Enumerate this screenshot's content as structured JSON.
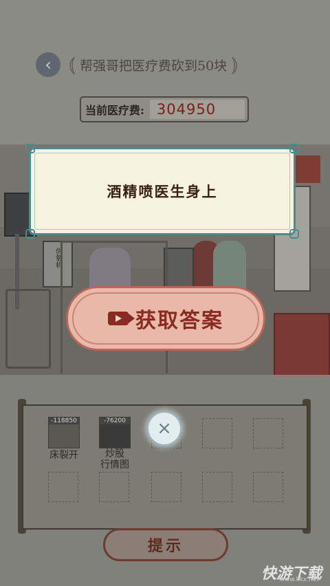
{
  "header": {
    "back_icon": "chevron-left-icon",
    "title": "帮强哥把医疗费砍到50块",
    "title_brace_left": "⦅",
    "title_brace_right": "⦆"
  },
  "fee": {
    "label": "当前医疗费:",
    "value": "304950"
  },
  "scene": {
    "sign_oxygen": "供氧机"
  },
  "dialog": {
    "text": "酒精喷医生身上"
  },
  "answer_button": {
    "icon": "video-icon",
    "label": "获取答案"
  },
  "inventory": {
    "items": [
      {
        "price": "-118850",
        "label": "床裂开"
      },
      {
        "price": "-76200",
        "label": "炒股\n行情图"
      }
    ],
    "close_icon": "close-icon",
    "close_glyph": "×"
  },
  "hint_button": {
    "label": "提示"
  },
  "watermark": {
    "brand": "快游下载",
    "url": "www.kkx.net"
  },
  "colors": {
    "dialog_border": "#4c8b8a",
    "answer_text": "#8b2a22",
    "fee_value": "#7c1f1a"
  }
}
